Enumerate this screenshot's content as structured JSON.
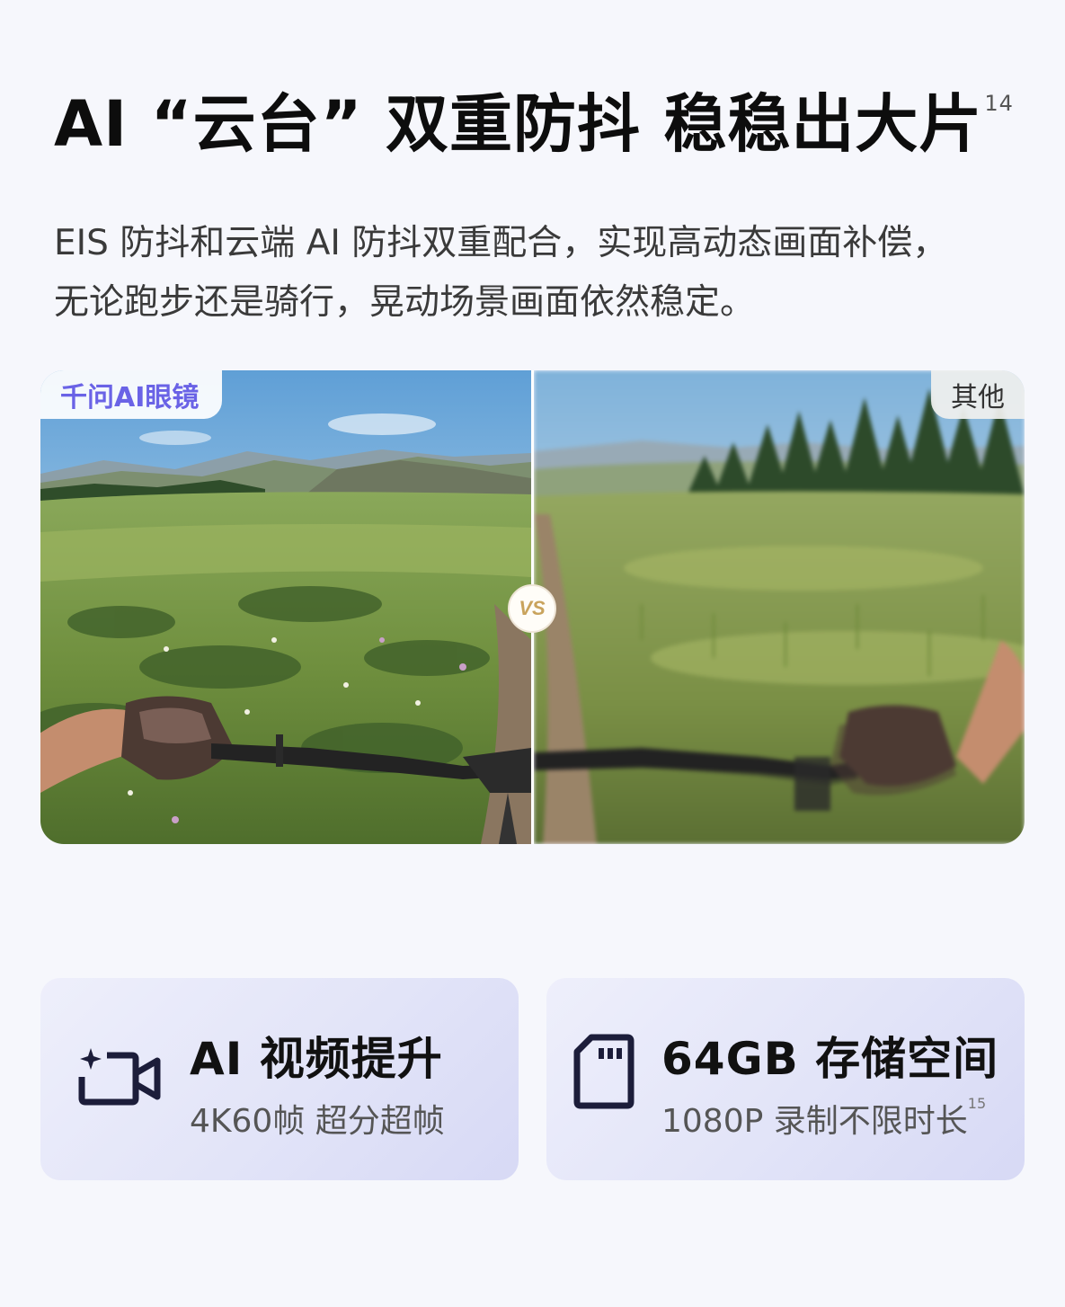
{
  "header": {
    "title": "AI “云台” 双重防抖 稳稳出大片",
    "title_footnote": "14",
    "description_lines": [
      "EIS 防抖和云端 AI 防抖双重配合，实现高动态画面补偿，",
      "无论跑步还是骑行，晃动场景画面依然稳定。"
    ]
  },
  "comparison": {
    "left_label": "千问AI眼镜",
    "right_label": "其他",
    "vs_label": "VS",
    "tag_color": "#6a63e6"
  },
  "features": [
    {
      "icon": "ai-video-camera-icon",
      "title": "AI 视频提升",
      "description": "4K60帧 超分超帧",
      "footnote": ""
    },
    {
      "icon": "sd-card-icon",
      "title": "64GB 存储空间",
      "description": "1080P 录制不限时长",
      "footnote": "15"
    }
  ],
  "colors": {
    "background": "#f6f7fc",
    "card_gradient_end": "#d7d9f5",
    "icon_color": "#1c1d3a"
  }
}
